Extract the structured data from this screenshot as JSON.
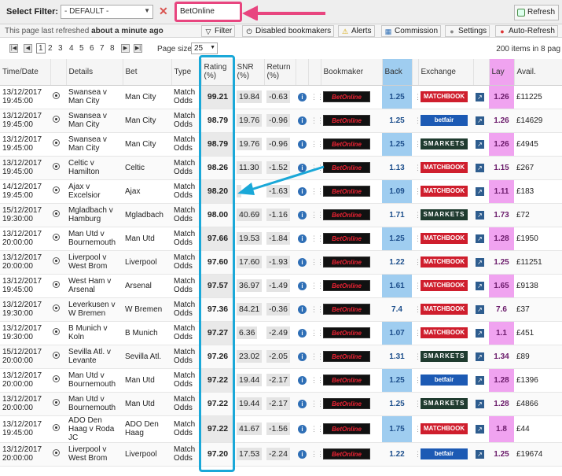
{
  "filter": {
    "label": "Select Filter:",
    "selected": "- DEFAULT -",
    "search_value": "BetOnline",
    "refresh_label": "Refresh"
  },
  "status": {
    "prefix": "This page last refreshed",
    "time": "about a minute ago"
  },
  "toolbar": {
    "filter": "Filter",
    "disabled": "Disabled bookmakers",
    "alerts": "Alerts",
    "commission": "Commission",
    "settings": "Settings",
    "autorefresh": "Auto-Refresh"
  },
  "pager": {
    "pages": [
      "1",
      "2",
      "3",
      "4",
      "5",
      "6",
      "7",
      "8"
    ],
    "page_size_label": "Page size:",
    "page_size": "25",
    "items_text": "200 items in 8 pag"
  },
  "columns": {
    "time": "Time/Date",
    "details": "Details",
    "bet": "Bet",
    "type": "Type",
    "rating": "Rating (%)",
    "snr": "SNR (%)",
    "return": "Return (%)",
    "bookmaker": "Bookmaker",
    "back": "Back",
    "exchange": "Exchange",
    "lay": "Lay",
    "avail": "Avail."
  },
  "rows": [
    {
      "date": "13/12/2017",
      "time": "19:45:00",
      "home": "Swansea v",
      "away": "Man City",
      "bet": "Man City",
      "type1": "Match",
      "type2": "Odds",
      "rating": "99.21",
      "snr": "19.84",
      "ret": "-0.63",
      "bookmaker": "BetOnline",
      "back": "1.25",
      "exchange": "MATCHBOOK",
      "lay": "1.26",
      "avail": "£11225"
    },
    {
      "date": "13/12/2017",
      "time": "19:45:00",
      "home": "Swansea v",
      "away": "Man City",
      "bet": "Man City",
      "type1": "Match",
      "type2": "Odds",
      "rating": "98.79",
      "snr": "19.76",
      "ret": "-0.96",
      "bookmaker": "BetOnline",
      "back": "1.25",
      "exchange": "betfair",
      "lay": "1.26",
      "avail": "£14629"
    },
    {
      "date": "13/12/2017",
      "time": "19:45:00",
      "home": "Swansea v",
      "away": "Man City",
      "bet": "Man City",
      "type1": "Match",
      "type2": "Odds",
      "rating": "98.79",
      "snr": "19.76",
      "ret": "-0.96",
      "bookmaker": "BetOnline",
      "back": "1.25",
      "exchange": "SMARKETS",
      "lay": "1.26",
      "avail": "£4945"
    },
    {
      "date": "13/12/2017",
      "time": "19:45:00",
      "home": "Celtic v",
      "away": "Hamilton",
      "bet": "Celtic",
      "type1": "Match",
      "type2": "Odds",
      "rating": "98.26",
      "snr": "11.30",
      "ret": "-1.52",
      "bookmaker": "BetOnline",
      "back": "1.13",
      "exchange": "MATCHBOOK",
      "lay": "1.15",
      "avail": "£267"
    },
    {
      "date": "14/12/2017",
      "time": "19:45:00",
      "home": "Ajax v",
      "away": "Excelsior",
      "bet": "Ajax",
      "type1": "Match",
      "type2": "Odds",
      "rating": "98.20",
      "snr": "",
      "ret": "-1.63",
      "bookmaker": "BetOnline",
      "back": "1.09",
      "exchange": "MATCHBOOK",
      "lay": "1.11",
      "avail": "£183"
    },
    {
      "date": "15/12/2017",
      "time": "19:30:00",
      "home": "Mgladbach v",
      "away": "Hamburg",
      "bet": "Mgladbach",
      "type1": "Match",
      "type2": "Odds",
      "rating": "98.00",
      "snr": "40.69",
      "ret": "-1.16",
      "bookmaker": "BetOnline",
      "back": "1.71",
      "exchange": "SMARKETS",
      "lay": "1.73",
      "avail": "£72"
    },
    {
      "date": "13/12/2017",
      "time": "20:00:00",
      "home": "Man Utd v",
      "away": "Bournemouth",
      "bet": "Man Utd",
      "type1": "Match",
      "type2": "Odds",
      "rating": "97.66",
      "snr": "19.53",
      "ret": "-1.84",
      "bookmaker": "BetOnline",
      "back": "1.25",
      "exchange": "MATCHBOOK",
      "lay": "1.28",
      "avail": "£1950"
    },
    {
      "date": "13/12/2017",
      "time": "20:00:00",
      "home": "Liverpool v",
      "away": "West Brom",
      "bet": "Liverpool",
      "type1": "Match",
      "type2": "Odds",
      "rating": "97.60",
      "snr": "17.60",
      "ret": "-1.93",
      "bookmaker": "BetOnline",
      "back": "1.22",
      "exchange": "MATCHBOOK",
      "lay": "1.25",
      "avail": "£11251"
    },
    {
      "date": "13/12/2017",
      "time": "19:45:00",
      "home": "West Ham v",
      "away": "Arsenal",
      "bet": "Arsenal",
      "type1": "Match",
      "type2": "Odds",
      "rating": "97.57",
      "snr": "36.97",
      "ret": "-1.49",
      "bookmaker": "BetOnline",
      "back": "1.61",
      "exchange": "MATCHBOOK",
      "lay": "1.65",
      "avail": "£9138"
    },
    {
      "date": "13/12/2017",
      "time": "19:30:00",
      "home": "Leverkusen v",
      "away": "W Bremen",
      "bet": "W Bremen",
      "type1": "Match",
      "type2": "Odds",
      "rating": "97.36",
      "snr": "84.21",
      "ret": "-0.36",
      "bookmaker": "BetOnline",
      "back": "7.4",
      "exchange": "MATCHBOOK",
      "lay": "7.6",
      "avail": "£37"
    },
    {
      "date": "13/12/2017",
      "time": "19:30:00",
      "home": "B Munich v",
      "away": "Koln",
      "bet": "B Munich",
      "type1": "Match",
      "type2": "Odds",
      "rating": "97.27",
      "snr": "6.36",
      "ret": "-2.49",
      "bookmaker": "BetOnline",
      "back": "1.07",
      "exchange": "MATCHBOOK",
      "lay": "1.1",
      "avail": "£451"
    },
    {
      "date": "15/12/2017",
      "time": "20:00:00",
      "home": "Sevilla Atl. v",
      "away": "Levante",
      "bet": "Sevilla Atl.",
      "type1": "Match",
      "type2": "Odds",
      "rating": "97.26",
      "snr": "23.02",
      "ret": "-2.05",
      "bookmaker": "BetOnline",
      "back": "1.31",
      "exchange": "SMARKETS",
      "lay": "1.34",
      "avail": "£89"
    },
    {
      "date": "13/12/2017",
      "time": "20:00:00",
      "home": "Man Utd v",
      "away": "Bournemouth",
      "bet": "Man Utd",
      "type1": "Match",
      "type2": "Odds",
      "rating": "97.22",
      "snr": "19.44",
      "ret": "-2.17",
      "bookmaker": "BetOnline",
      "back": "1.25",
      "exchange": "betfair",
      "lay": "1.28",
      "avail": "£1396"
    },
    {
      "date": "13/12/2017",
      "time": "20:00:00",
      "home": "Man Utd v",
      "away": "Bournemouth",
      "bet": "Man Utd",
      "type1": "Match",
      "type2": "Odds",
      "rating": "97.22",
      "snr": "19.44",
      "ret": "-2.17",
      "bookmaker": "BetOnline",
      "back": "1.25",
      "exchange": "SMARKETS",
      "lay": "1.28",
      "avail": "£4866"
    },
    {
      "date": "13/12/2017",
      "time": "19:45:00",
      "home": "ADO Den",
      "away": "Haag v Roda JC",
      "bet": "ADO Den Haag",
      "type1": "Match",
      "type2": "Odds",
      "rating": "97.22",
      "snr": "41.67",
      "ret": "-1.56",
      "bookmaker": "BetOnline",
      "back": "1.75",
      "exchange": "MATCHBOOK",
      "lay": "1.8",
      "avail": "£44"
    },
    {
      "date": "13/12/2017",
      "time": "20:00:00",
      "home": "Liverpool v",
      "away": "West Brom",
      "bet": "Liverpool",
      "type1": "Match",
      "type2": "Odds",
      "rating": "97.20",
      "snr": "17.53",
      "ret": "-2.24",
      "bookmaker": "BetOnline",
      "back": "1.22",
      "exchange": "betfair",
      "lay": "1.25",
      "avail": "£19674"
    }
  ],
  "colors": {
    "back": "#9fcdf0",
    "lay": "#f0a3f0",
    "highlight_box": "#1aa8d8",
    "search_highlight": "#e8457f"
  }
}
